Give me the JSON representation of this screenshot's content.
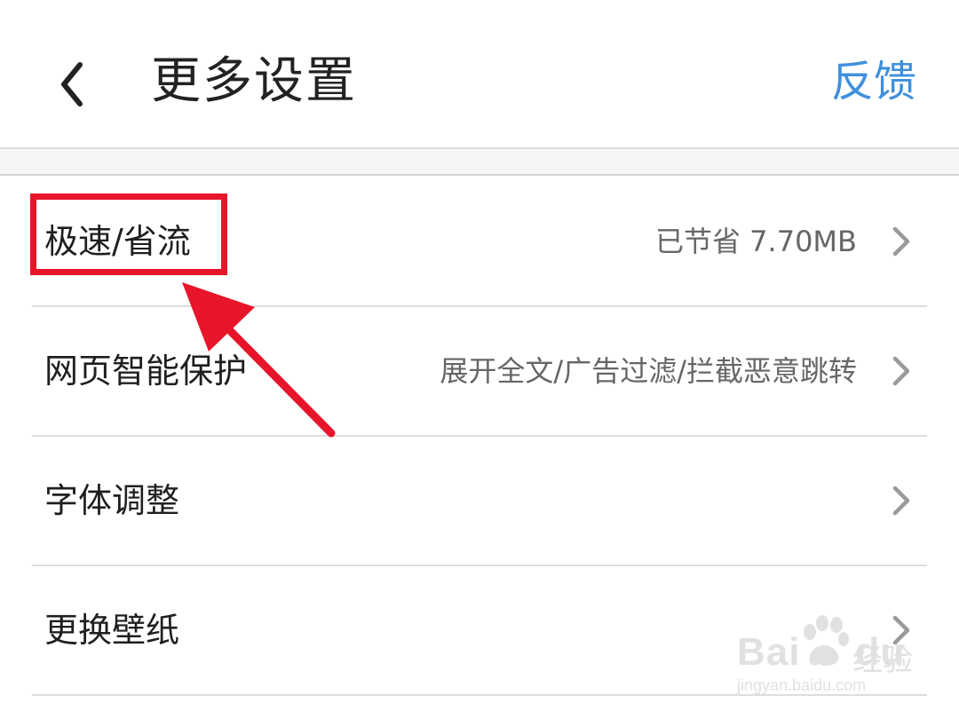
{
  "header": {
    "title": "更多设置",
    "feedback_label": "反馈",
    "back_icon": "chevron-left-icon"
  },
  "settings": [
    {
      "label": "极速/省流",
      "value": "已节省 7.70MB"
    },
    {
      "label": "网页智能保护",
      "value": "展开全文/广告过滤/拦截恶意跳转"
    },
    {
      "label": "字体调整",
      "value": ""
    },
    {
      "label": "更换壁纸",
      "value": ""
    }
  ],
  "colors": {
    "accent": "#3f8fdc",
    "annotation": "#e8152a",
    "divider": "#dddddd",
    "text_primary": "#1f1f1f",
    "text_secondary": "#666666"
  },
  "watermark": {
    "brand": "Bai",
    "brand_suffix": "du",
    "sub": "经验",
    "url": "jingyan.baidu.com"
  }
}
